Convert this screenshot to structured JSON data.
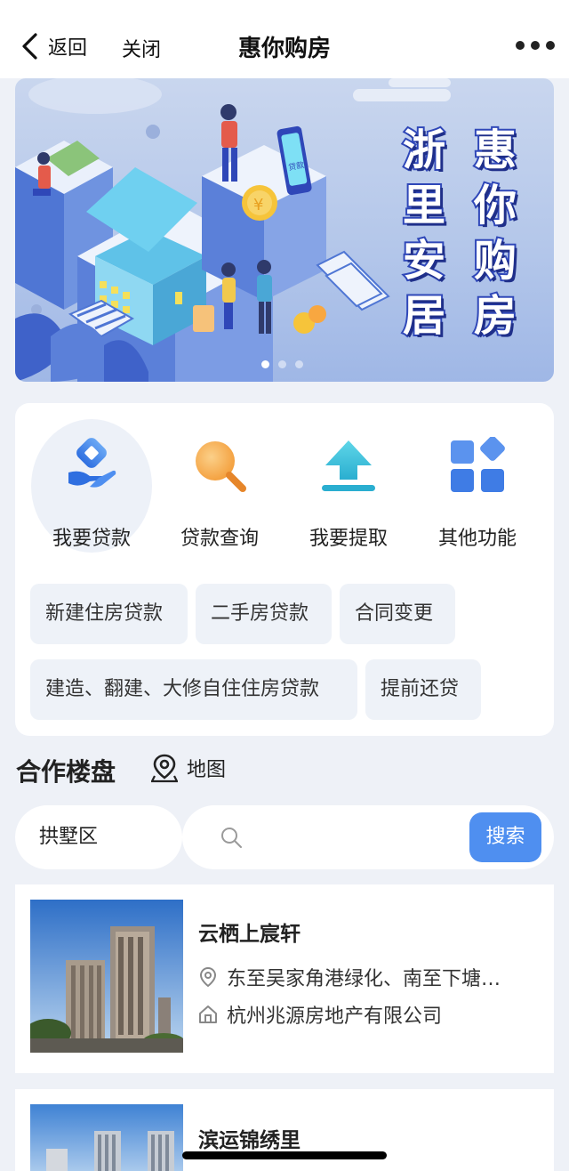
{
  "nav": {
    "back_label": "返回",
    "close_label": "关闭",
    "title": "惠你购房"
  },
  "banner": {
    "title_col_left": [
      "浙",
      "里",
      "安",
      "居"
    ],
    "title_col_right": [
      "惠",
      "你",
      "购",
      "房"
    ],
    "sign_text": "贷款",
    "active_slide": 1,
    "slide_count": 3
  },
  "functions": [
    {
      "label": "我要贷款",
      "icon": "hand-diamond-icon"
    },
    {
      "label": "贷款查询",
      "icon": "magnifier-icon"
    },
    {
      "label": "我要提取",
      "icon": "upload-arrow-icon"
    },
    {
      "label": "其他功能",
      "icon": "grid-apps-icon"
    }
  ],
  "loan_tags": [
    "新建住房贷款",
    "二手房贷款",
    "合同变更",
    "建造、翻建、大修自住住房贷款",
    "提前还贷"
  ],
  "section": {
    "title": "合作楼盘",
    "map_label": "地图"
  },
  "search": {
    "district": "拱墅区",
    "placeholder": "",
    "button_label": "搜索"
  },
  "listings": [
    {
      "name": "云栖上宸轩",
      "address": "东至吴家角港绿化、南至下塘…",
      "developer": "杭州兆源房地产有限公司"
    },
    {
      "name": "滨运锦绣里"
    }
  ],
  "colors": {
    "accent": "#4f8ff0",
    "background": "#eef1f7"
  }
}
